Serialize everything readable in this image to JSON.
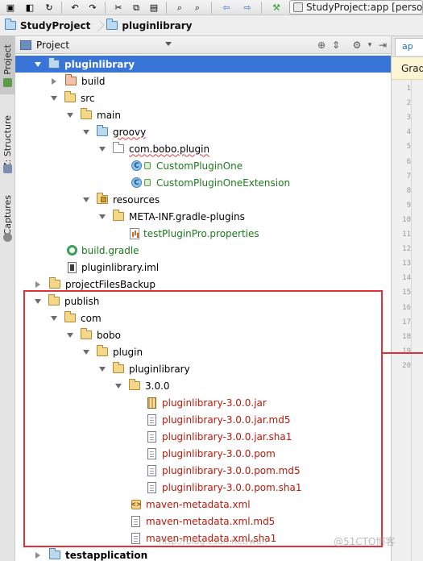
{
  "toolbar": {
    "run_config_label": "StudyProject:app [person"
  },
  "breadcrumb": {
    "items": [
      "StudyProject",
      "pluginlibrary"
    ]
  },
  "side_tabs": {
    "project": "1: Project",
    "structure": "Z: Structure",
    "captures": "Captures"
  },
  "project_panel": {
    "view_mode": "Project"
  },
  "editor": {
    "tab_label": "ap",
    "crumb_label": "Grad",
    "line_numbers": [
      "1",
      "2",
      "3",
      "4",
      "5",
      "6",
      "7",
      "8",
      "9",
      "10",
      "11",
      "12",
      "13",
      "14",
      "15",
      "16",
      "17",
      "18",
      "19",
      "20"
    ]
  },
  "tree": {
    "rows": [
      {
        "label": "pluginlibrary"
      },
      {
        "label": "build"
      },
      {
        "label": "src"
      },
      {
        "label": "main"
      },
      {
        "label": "groovy"
      },
      {
        "label": "com.bobo.plugin"
      },
      {
        "label": "CustomPluginOne"
      },
      {
        "label": "CustomPluginOneExtension"
      },
      {
        "label": "resources"
      },
      {
        "label": "META-INF.gradle-plugins"
      },
      {
        "label": "testPluginPro.properties"
      },
      {
        "label": "build.gradle"
      },
      {
        "label": "pluginlibrary.iml"
      },
      {
        "label": "projectFilesBackup"
      },
      {
        "label": "publish"
      },
      {
        "label": "com"
      },
      {
        "label": "bobo"
      },
      {
        "label": "plugin"
      },
      {
        "label": "pluginlibrary"
      },
      {
        "label": "3.0.0"
      },
      {
        "label": "pluginlibrary-3.0.0.jar"
      },
      {
        "label": "pluginlibrary-3.0.0.jar.md5"
      },
      {
        "label": "pluginlibrary-3.0.0.jar.sha1"
      },
      {
        "label": "pluginlibrary-3.0.0.pom"
      },
      {
        "label": "pluginlibrary-3.0.0.pom.md5"
      },
      {
        "label": "pluginlibrary-3.0.0.pom.sha1"
      },
      {
        "label": "maven-metadata.xml"
      },
      {
        "label": "maven-metadata.xml.md5"
      },
      {
        "label": "maven-metadata.xml.sha1"
      },
      {
        "label": "testapplication"
      }
    ]
  },
  "colors": {
    "highlight_box": "#e0303a",
    "selection_row": "#3875d7",
    "module_row": "#fbf5d3",
    "red_file_text": "#b8190a",
    "green_file_text": "#1c7a1c"
  },
  "watermark": {
    "text": "http://blog.csdn.net/wan",
    "logo_text": "@51CTO博客"
  }
}
